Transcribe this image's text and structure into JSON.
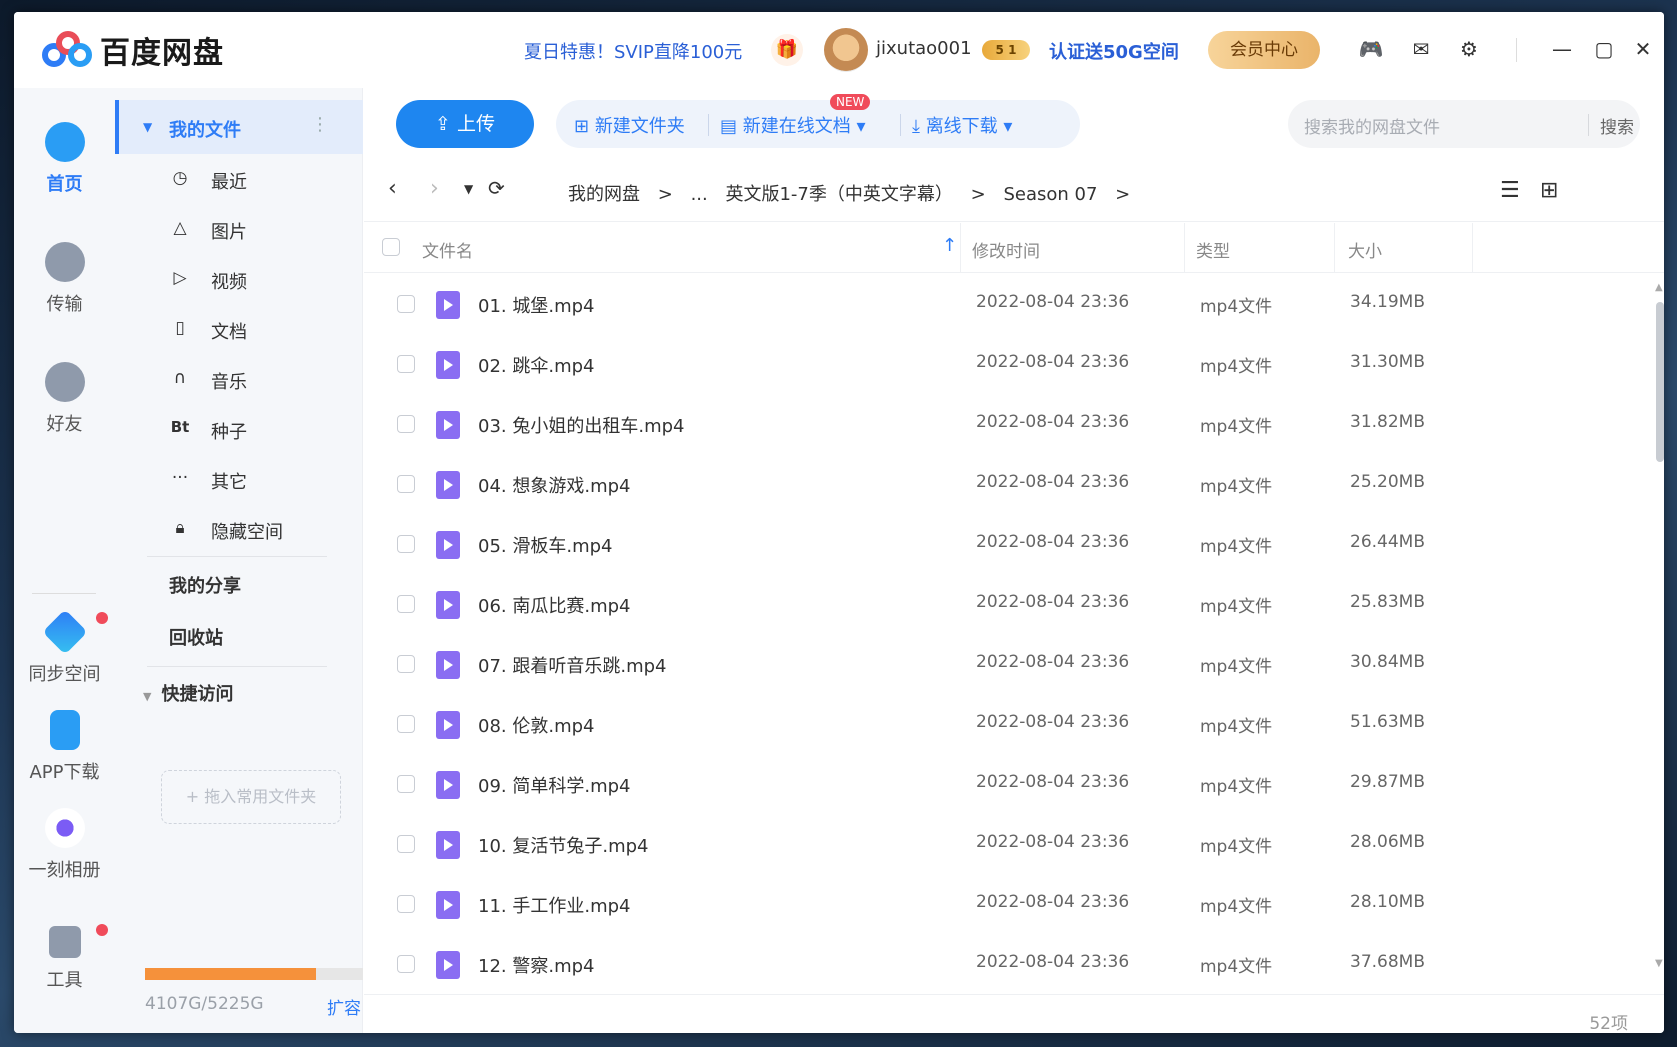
{
  "app": {
    "title": "百度网盘"
  },
  "titlebar": {
    "promo": "夏日特惠！SVIP直降100元",
    "username": "jixutao001",
    "vip_badge": "5 1",
    "cert": "认证送50G空间",
    "member_center": "会员中心"
  },
  "leftnav": {
    "items": [
      {
        "label": "首页",
        "icon": "cloud-home-icon",
        "active": true
      },
      {
        "label": "传输",
        "icon": "transfer-icon"
      },
      {
        "label": "好友",
        "icon": "friends-icon"
      },
      {
        "label": "同步空间",
        "icon": "sync-icon"
      },
      {
        "label": "APP下载",
        "icon": "phone-icon"
      },
      {
        "label": "一刻相册",
        "icon": "album-icon"
      },
      {
        "label": "工具",
        "icon": "tools-icon"
      }
    ]
  },
  "sidebar": {
    "my_files": "我的文件",
    "items": [
      {
        "label": "最近",
        "icon": "clock-icon"
      },
      {
        "label": "图片",
        "icon": "mountain-icon"
      },
      {
        "label": "视频",
        "icon": "play-icon"
      },
      {
        "label": "文档",
        "icon": "doc-icon"
      },
      {
        "label": "音乐",
        "icon": "headphones-icon"
      },
      {
        "label": "种子",
        "icon": "bt-icon",
        "glyph": "Bt"
      },
      {
        "label": "其它",
        "icon": "more-icon"
      },
      {
        "label": "隐藏空间",
        "icon": "lock-icon"
      }
    ],
    "my_share": "我的分享",
    "recycle": "回收站",
    "quick_access": "快捷访问",
    "drag_hint": "+ 拖入常用文件夹",
    "quota_text": "4107G/5225G",
    "quota_fraction": 0.786,
    "expand": "扩容"
  },
  "toolbar": {
    "upload": "上传",
    "new_folder": "新建文件夹",
    "new_online_doc": "新建在线文档",
    "new_badge": "NEW",
    "offline_download": "离线下载",
    "search_placeholder": "搜索我的网盘文件",
    "search_button": "搜索"
  },
  "breadcrumb": {
    "root": "我的网盘",
    "ellipsis": "...",
    "parent": "英文版1-7季（中英文字幕）",
    "current": "Season 07",
    "sep": ">"
  },
  "table": {
    "headers": {
      "name": "文件名",
      "modified": "修改时间",
      "type": "类型",
      "size": "大小"
    },
    "rows": [
      {
        "name": "01. 城堡.mp4",
        "modified": "2022-08-04 23:36",
        "type": "mp4文件",
        "size": "34.19MB"
      },
      {
        "name": "02. 跳伞.mp4",
        "modified": "2022-08-04 23:36",
        "type": "mp4文件",
        "size": "31.30MB"
      },
      {
        "name": "03. 兔小姐的出租车.mp4",
        "modified": "2022-08-04 23:36",
        "type": "mp4文件",
        "size": "31.82MB"
      },
      {
        "name": "04. 想象游戏.mp4",
        "modified": "2022-08-04 23:36",
        "type": "mp4文件",
        "size": "25.20MB"
      },
      {
        "name": "05. 滑板车.mp4",
        "modified": "2022-08-04 23:36",
        "type": "mp4文件",
        "size": "26.44MB"
      },
      {
        "name": "06. 南瓜比赛.mp4",
        "modified": "2022-08-04 23:36",
        "type": "mp4文件",
        "size": "25.83MB"
      },
      {
        "name": "07. 跟着听音乐跳.mp4",
        "modified": "2022-08-04 23:36",
        "type": "mp4文件",
        "size": "30.84MB"
      },
      {
        "name": "08. 伦敦.mp4",
        "modified": "2022-08-04 23:36",
        "type": "mp4文件",
        "size": "51.63MB"
      },
      {
        "name": "09. 简单科学.mp4",
        "modified": "2022-08-04 23:36",
        "type": "mp4文件",
        "size": "29.87MB"
      },
      {
        "name": "10. 复活节兔子.mp4",
        "modified": "2022-08-04 23:36",
        "type": "mp4文件",
        "size": "28.06MB"
      },
      {
        "name": "11. 手工作业.mp4",
        "modified": "2022-08-04 23:36",
        "type": "mp4文件",
        "size": "28.10MB"
      },
      {
        "name": "12. 警察.mp4",
        "modified": "2022-08-04 23:36",
        "type": "mp4文件",
        "size": "37.68MB"
      }
    ]
  },
  "footer": {
    "count": "52项"
  },
  "colors": {
    "accent": "#2e7cf6",
    "upload": "#1e86f0",
    "quota": "#f5913b",
    "file_icon": "#8a6df2"
  }
}
